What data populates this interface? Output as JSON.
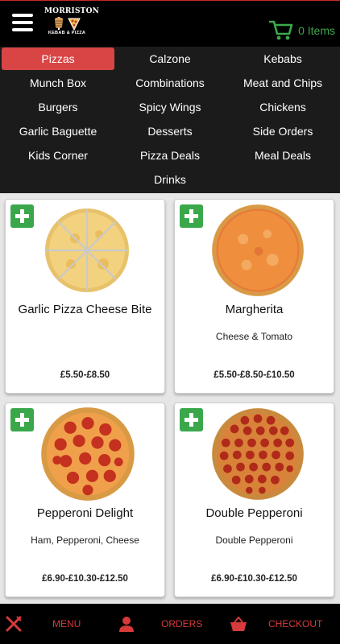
{
  "header": {
    "logo_top": "MORRISTON",
    "logo_bottom": "KEBAB & PIZZA",
    "cart_label": "0 Items",
    "accent_color": "#3aa84a"
  },
  "categories": [
    {
      "label": "Pizzas",
      "active": true
    },
    {
      "label": "Calzone"
    },
    {
      "label": "Kebabs"
    },
    {
      "label": "Munch Box"
    },
    {
      "label": "Combinations"
    },
    {
      "label": "Meat and Chips"
    },
    {
      "label": "Burgers"
    },
    {
      "label": "Spicy Wings"
    },
    {
      "label": "Chickens"
    },
    {
      "label": "Garlic Baguette"
    },
    {
      "label": "Desserts"
    },
    {
      "label": "Side Orders"
    },
    {
      "label": "Kids Corner"
    },
    {
      "label": "Pizza Deals"
    },
    {
      "label": "Meal Deals"
    },
    {
      "label": "Drinks"
    }
  ],
  "products": [
    {
      "title": "Garlic Pizza Cheese Bite",
      "description": "",
      "price": "£5.50-£8.50",
      "image": "garlic-pizza-image"
    },
    {
      "title": "Margherita",
      "description": "Cheese & Tomato",
      "price": "£5.50-£8.50-£10.50",
      "image": "margherita-pizza-image"
    },
    {
      "title": "Pepperoni Delight",
      "description": "Ham, Pepperoni, Cheese",
      "price": "£6.90-£10.30-£12.50",
      "image": "pepperoni-pizza-image"
    },
    {
      "title": "Double Pepperoni",
      "description": "Double Pepperoni",
      "price": "£6.90-£10.30-£12.50",
      "image": "double-pepperoni-pizza-image"
    }
  ],
  "footer": {
    "menu_label": "MENU",
    "orders_label": "ORDERS",
    "checkout_label": "CHECKOUT",
    "accent_color": "#d63a3a"
  }
}
